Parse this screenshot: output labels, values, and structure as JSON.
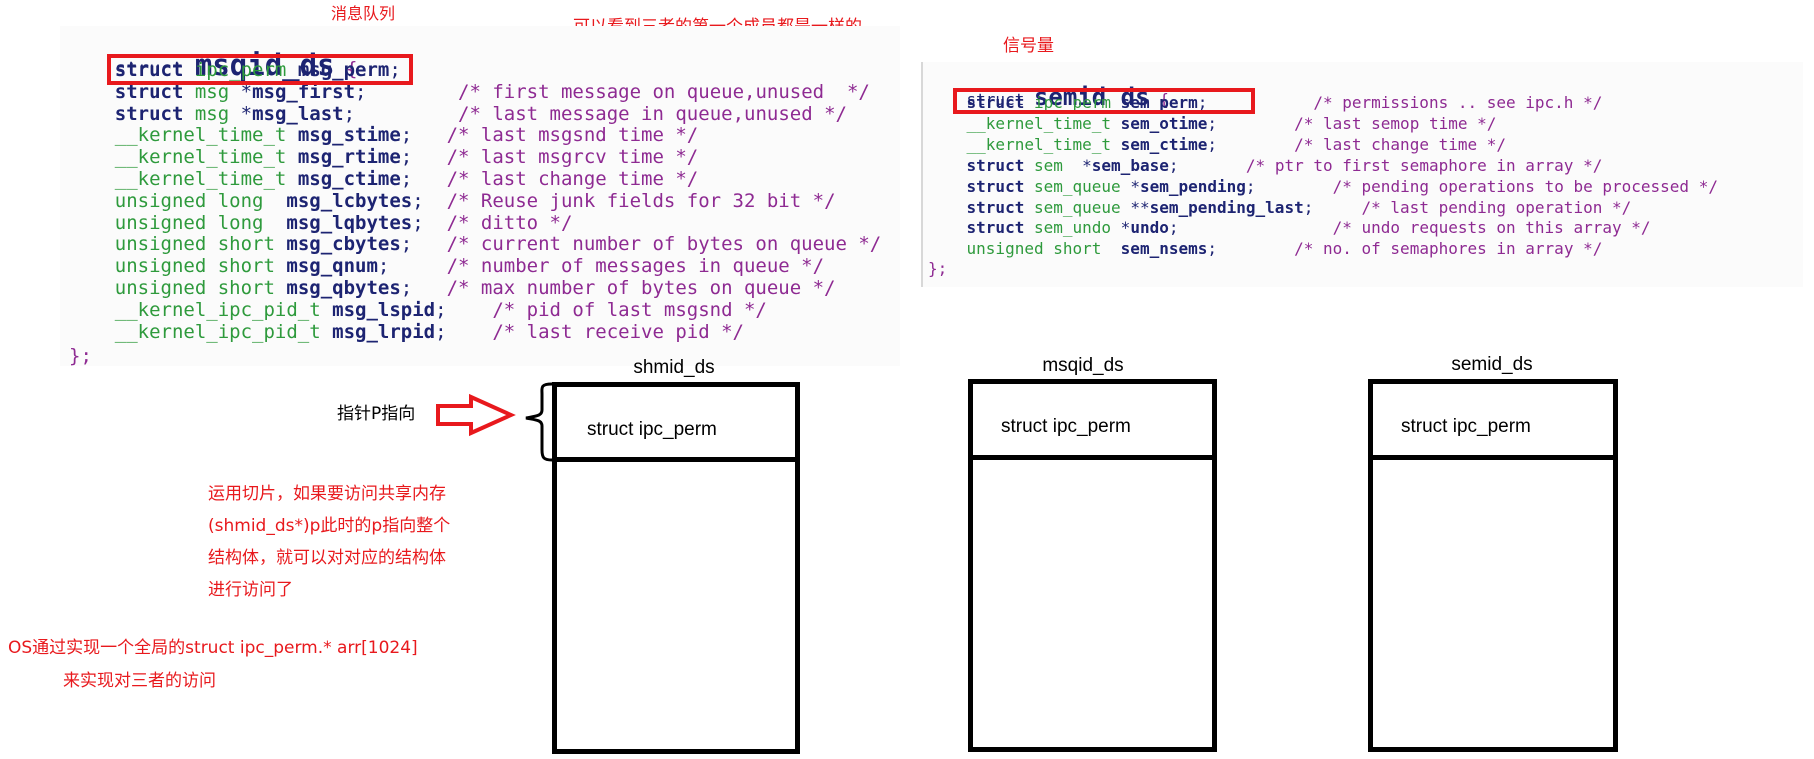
{
  "annotations": {
    "msg_queue_label": "消息队列",
    "same_first_member": "可以看到三者的第一个成员都是一样的",
    "semaphore_label": "信号量",
    "pointer_label": "指针P指向",
    "slicing_note": [
      "运用切片，如果要访问共享内存",
      "(shmid_ds*)p此时的p指向整个",
      "结构体，就可以对对应的结构体",
      "进行访问了"
    ],
    "os_note": [
      "OS通过实现一个全局的struct ipc_perm.*  arr[1024]",
      "来实现对三者的访问"
    ]
  },
  "msqid_struct": {
    "keyword": "struct",
    "name": "msqid_ds",
    "open": "{",
    "close": "};",
    "members": [
      {
        "type_kw": "struct",
        "type": "ipc_perm",
        "ptr": "",
        "name": "msg_perm",
        "pad": "",
        "comment": ""
      },
      {
        "type_kw": "struct",
        "type": "msg",
        "ptr": "*",
        "name": "msg_first",
        "pad": "       ",
        "comment": "/* first message on queue,unused  */"
      },
      {
        "type_kw": "struct",
        "type": "msg",
        "ptr": "*",
        "name": "msg_last",
        "pad": "        ",
        "comment": "/* last message in queue,unused */"
      },
      {
        "type_kw": "",
        "type": "__kernel_time_t",
        "ptr": "",
        "name": "msg_stime",
        "pad": "  ",
        "comment": "/* last msgsnd time */"
      },
      {
        "type_kw": "",
        "type": "__kernel_time_t",
        "ptr": "",
        "name": "msg_rtime",
        "pad": "  ",
        "comment": "/* last msgrcv time */"
      },
      {
        "type_kw": "",
        "type": "__kernel_time_t",
        "ptr": "",
        "name": "msg_ctime",
        "pad": "  ",
        "comment": "/* last change time */"
      },
      {
        "type_kw": "",
        "type": "unsigned long ",
        "ptr": "",
        "name": "msg_lcbytes",
        "pad": " ",
        "comment": "/* Reuse junk fields for 32 bit */"
      },
      {
        "type_kw": "",
        "type": "unsigned long ",
        "ptr": "",
        "name": "msg_lqbytes",
        "pad": " ",
        "comment": "/* ditto */"
      },
      {
        "type_kw": "",
        "type": "unsigned short",
        "ptr": "",
        "name": "msg_cbytes",
        "pad": "  ",
        "comment": "/* current number of bytes on queue */"
      },
      {
        "type_kw": "",
        "type": "unsigned short",
        "ptr": "",
        "name": "msg_qnum",
        "pad": "    ",
        "comment": "/* number of messages in queue */"
      },
      {
        "type_kw": "",
        "type": "unsigned short",
        "ptr": "",
        "name": "msg_qbytes",
        "pad": "  ",
        "comment": "/* max number of bytes on queue */"
      },
      {
        "type_kw": "",
        "type": "__kernel_ipc_pid_t",
        "ptr": "",
        "name": "msg_lspid",
        "pad": "   ",
        "comment": "/* pid of last msgsnd */"
      },
      {
        "type_kw": "",
        "type": "__kernel_ipc_pid_t",
        "ptr": "",
        "name": "msg_lrpid",
        "pad": "   ",
        "comment": "/* last receive pid */"
      }
    ]
  },
  "semid_struct": {
    "keyword": "struct",
    "name": "semid ds",
    "open": "{",
    "close": "};",
    "members": [
      {
        "type_kw": "struct",
        "type": "ipc perm",
        "ptr": "",
        "name": "sem perm",
        "pad": "          ",
        "comment": "/* permissions .. see ipc.h */"
      },
      {
        "type_kw": "",
        "type": "__kernel_time_t",
        "ptr": "",
        "name": "sem_otime",
        "pad": "       ",
        "comment": "/* last semop time */"
      },
      {
        "type_kw": "",
        "type": "__kernel_time_t",
        "ptr": "",
        "name": "sem_ctime",
        "pad": "       ",
        "comment": "/* last change time */"
      },
      {
        "type_kw": "struct",
        "type": "sem ",
        "ptr": "*",
        "name": "sem_base",
        "pad": "      ",
        "comment": "/* ptr to first semaphore in array */"
      },
      {
        "type_kw": "struct",
        "type": "sem_queue",
        "ptr": "*",
        "name": "sem_pending",
        "pad": "       ",
        "comment": "/* pending operations to be processed */"
      },
      {
        "type_kw": "struct",
        "type": "sem_queue",
        "ptr": "**",
        "name": "sem_pending_last",
        "pad": "    ",
        "comment": "/* last pending operation */"
      },
      {
        "type_kw": "struct",
        "type": "sem_undo",
        "ptr": "*",
        "name": "undo",
        "pad": "               ",
        "comment": "/* undo requests on this array */"
      },
      {
        "type_kw": "",
        "type": "unsigned short ",
        "ptr": "",
        "name": "sem_nsems",
        "pad": "       ",
        "comment": "/* no. of semaphores in array */"
      }
    ]
  },
  "diagram": {
    "boxes": [
      {
        "title": "shmid_ds",
        "header": "struct ipc_perm"
      },
      {
        "title": "msqid_ds",
        "header": "struct ipc_perm"
      },
      {
        "title": "semid_ds",
        "header": "struct ipc_perm"
      }
    ]
  },
  "colors": {
    "annotation": "#e8191d",
    "keyword": "#1d2472",
    "type": "#2e9a3c",
    "comment": "#8e2a92"
  }
}
